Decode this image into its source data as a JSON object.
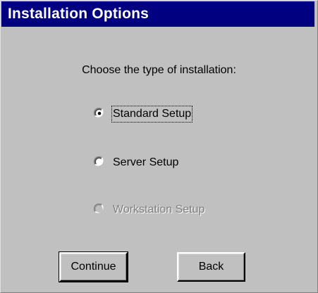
{
  "window": {
    "title": "Installation Options"
  },
  "prompt": "Choose the type of installation:",
  "options": [
    {
      "label": "Standard Setup",
      "selected": true,
      "enabled": true
    },
    {
      "label": "Server Setup",
      "selected": false,
      "enabled": true
    },
    {
      "label": "Workstation Setup",
      "selected": false,
      "enabled": false
    }
  ],
  "buttons": {
    "continue_label": "Continue",
    "back_label": "Back"
  },
  "colors": {
    "titlebar": "#000080",
    "titlebar_text": "#ffffff",
    "dialog_face": "#c0c0c0",
    "disabled_text": "#808080"
  },
  "icons": {
    "radio_selected": "radio-button-selected-icon",
    "radio_unselected": "radio-button-icon",
    "radio_disabled": "radio-button-disabled-icon"
  }
}
